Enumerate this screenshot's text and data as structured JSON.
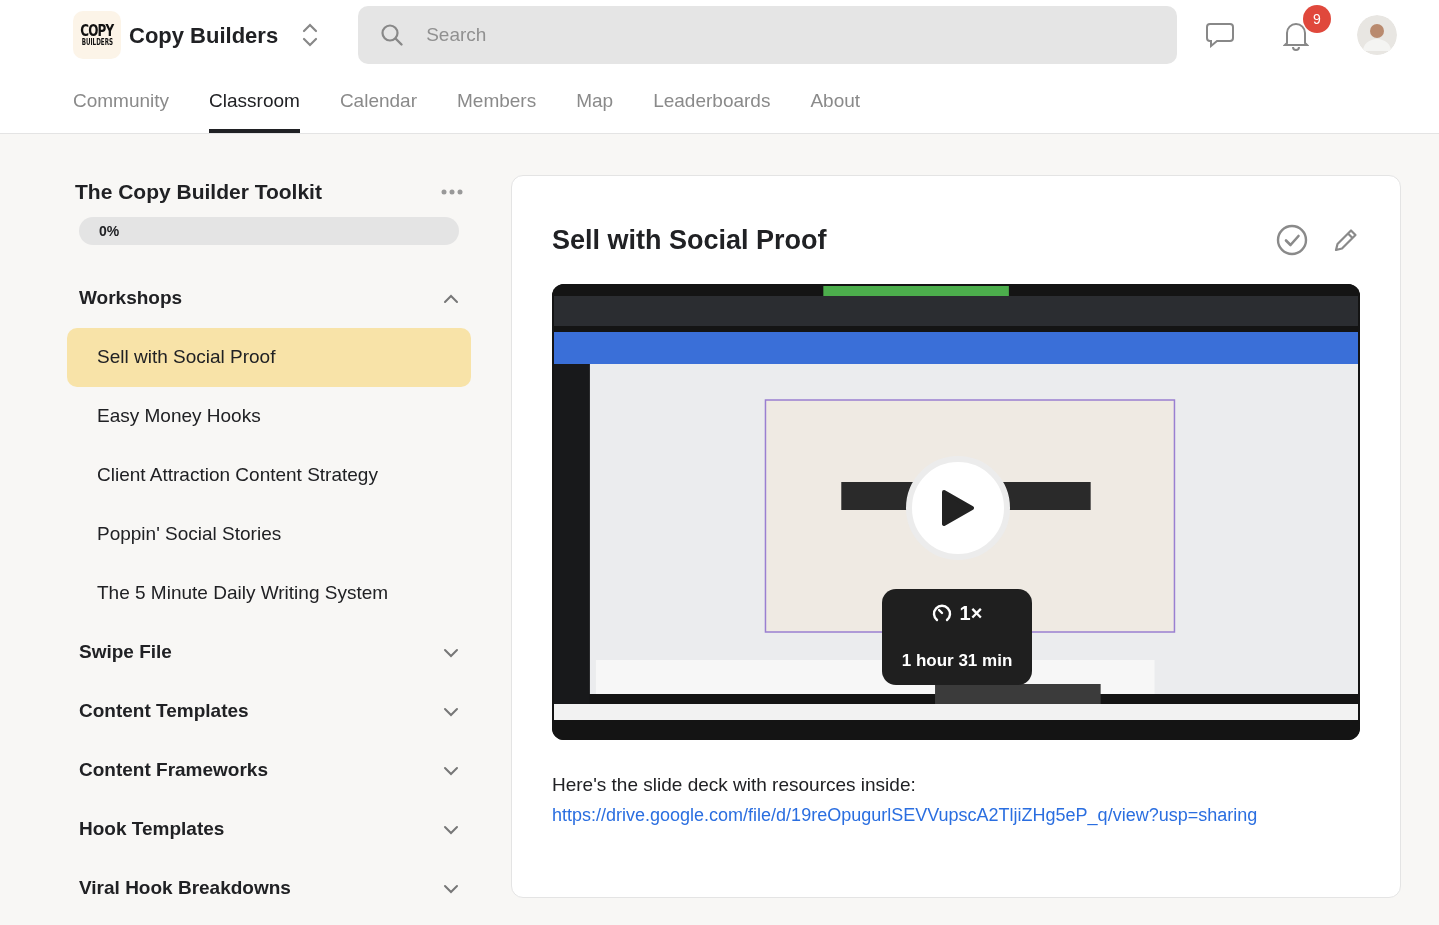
{
  "header": {
    "logo": {
      "line_1": "COPY",
      "line_2": "BUILDERS"
    },
    "community_name": "Copy Builders",
    "search": {
      "placeholder": "Search"
    },
    "notifications": {
      "count": "9"
    }
  },
  "tabs": [
    {
      "label": "Community",
      "selected": false
    },
    {
      "label": "Classroom",
      "selected": true
    },
    {
      "label": "Calendar",
      "selected": false
    },
    {
      "label": "Members",
      "selected": false
    },
    {
      "label": "Map",
      "selected": false
    },
    {
      "label": "Leaderboards",
      "selected": false
    },
    {
      "label": "About",
      "selected": false
    }
  ],
  "course": {
    "title": "The Copy Builder Toolkit",
    "progress": {
      "level": 0,
      "reading": "0%"
    },
    "sections": [
      {
        "title": "Workshops",
        "expanded": true,
        "lessons": [
          {
            "title": "Sell with Social Proof",
            "selected": true
          },
          {
            "title": "Easy Money Hooks",
            "selected": false
          },
          {
            "title": "Client Attraction Content Strategy",
            "selected": false
          },
          {
            "title": "Poppin' Social Stories",
            "selected": false
          },
          {
            "title": "The 5 Minute Daily Writing System",
            "selected": false
          }
        ]
      },
      {
        "title": "Swipe File",
        "expanded": false
      },
      {
        "title": "Content Templates",
        "expanded": false
      },
      {
        "title": "Content Frameworks",
        "expanded": false
      },
      {
        "title": "Hook Templates",
        "expanded": false
      },
      {
        "title": "Viral Hook Breakdowns",
        "expanded": false
      }
    ]
  },
  "lesson": {
    "title": "Sell with Social Proof",
    "completed": false,
    "video": {
      "speed": "1×",
      "duration": "1 hour 31 min"
    },
    "description": {
      "text": "Here's the slide deck with resources inside:",
      "link": "https://drive.google.com/file/d/19reOpugurlSEVVupscA2TljiZHg5eP_q/view?usp=sharing"
    }
  }
}
